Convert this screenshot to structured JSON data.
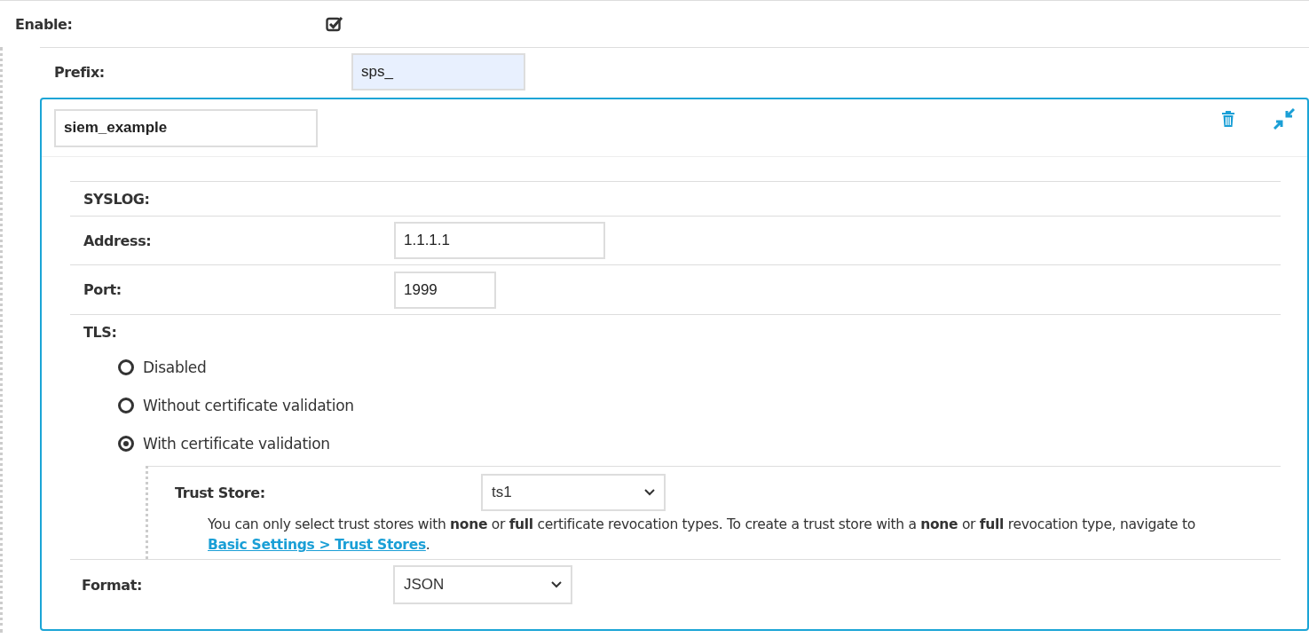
{
  "enable": {
    "label": "Enable:",
    "checked": true
  },
  "prefix": {
    "label": "Prefix:",
    "value": "sps_"
  },
  "card": {
    "name": "siem_example",
    "section_title": "SYSLOG:",
    "address": {
      "label": "Address:",
      "value": "1.1.1.1"
    },
    "port": {
      "label": "Port:",
      "value": "1999"
    },
    "tls": {
      "label": "TLS:",
      "options": [
        {
          "label": "Disabled",
          "selected": false
        },
        {
          "label": "Without certificate validation",
          "selected": false
        },
        {
          "label": "With certificate validation",
          "selected": true
        }
      ]
    },
    "trust_store": {
      "label": "Trust Store:",
      "value": "ts1",
      "help": "You can only select trust stores with **none** or **full** certificate revocation types. To create a trust store with a **none** or **full** revocation type, navigate to ",
      "link": "Basic Settings > Trust Stores",
      "help_end": "."
    },
    "format": {
      "label": "Format:",
      "value": "JSON"
    }
  }
}
